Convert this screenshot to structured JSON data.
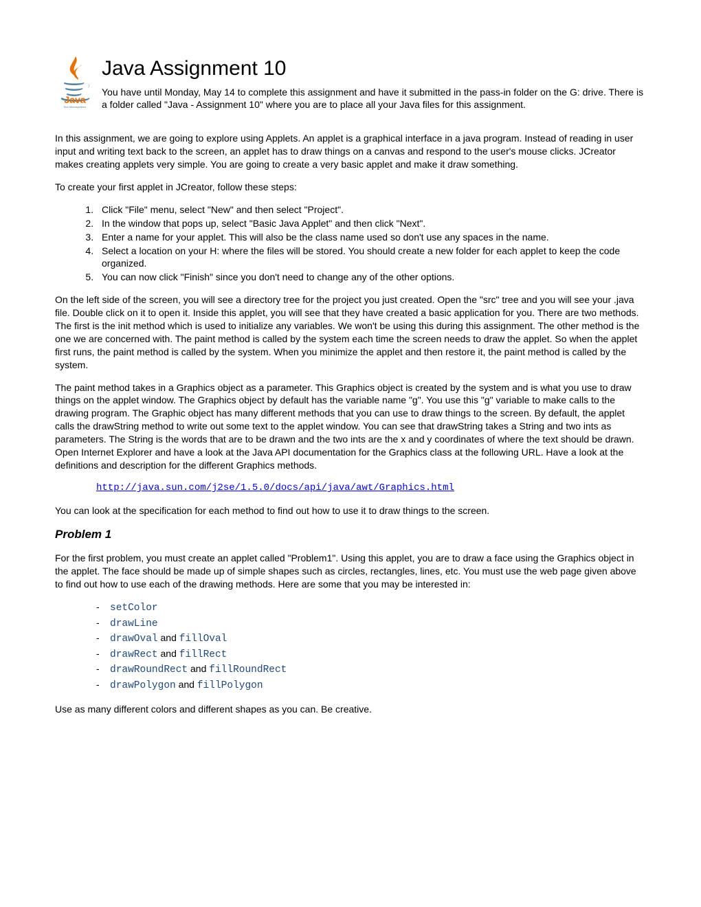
{
  "title": "Java Assignment 10",
  "intro_under_title": "You have until Monday, May 14 to complete this assignment and have it submitted in the pass-in folder on the G: drive. There is a folder called \"Java - Assignment 10\" where you are to place all your Java files for this assignment.",
  "para2": "In this assignment, we are going to explore using Applets. An applet is a graphical interface in a java program. Instead of reading in user input and writing text back to the screen, an applet has to draw things on a canvas and respond to the user's mouse clicks. JCreator makes creating applets very simple. You are going to create a very basic applet and make it draw something.",
  "steps_label": "To create your first applet in JCreator, follow these steps:",
  "steps": [
    "Click \"File\" menu, select \"New\" and then select \"Project\".",
    "In the window that pops up, select \"Basic Java Applet\" and then click \"Next\".",
    "Enter a name for your applet. This will also be the class name used so don't use any spaces in the name.",
    "Select a location on your H: where the files will be stored. You should create a new folder for each applet to keep the code organized.",
    "You can now click \"Finish\" since you don't need to change any of the other options."
  ],
  "para3": "On the left side of the screen, you will see a directory tree for the project you just created. Open the \"src\" tree and you will see your .java file. Double click on it to open it. Inside this applet, you will see that they have created a basic application for you. There are two methods. The first is the init method which is used to initialize any variables. We won't be using this during this assignment. The other method is the one we are concerned with. The paint method is called by the system each time the screen needs to draw the applet. So when the applet first runs, the paint method is called by the system. When you minimize the applet and then restore it, the paint method is called by the system.",
  "para4": "The paint method takes in a Graphics object as a parameter. This Graphics object is created by the system and is what you use to draw things on the applet window. The Graphics object by default has the variable name \"g\". You use this \"g\" variable to make calls to the drawing program. The Graphic object has many different methods that you can use to draw things to the screen. By default, the applet calls the drawString method to write out some text to the applet window. You can see that drawString takes a String and two ints as parameters. The String is the words that are to be drawn and the two ints are the x and y coordinates of where the text should be drawn. Open Internet Explorer and have a look at the Java API documentation for the Graphics class at the following URL. Have a look at the definitions and description for the different Graphics methods.",
  "url": "http://java.sun.com/j2se/1.5.0/docs/api/java/awt/Graphics.html",
  "para5": "You can look at the specification for each method to find out how to use it to draw things to the screen.",
  "problem1_heading": "Problem 1",
  "problem1_para": "For the first problem, you must create an applet called \"Problem1\". Using this applet, you are to draw a face using the Graphics object in the applet. The face should be made up of simple shapes such as circles, rectangles, lines, etc. You must use the web page given above to find out how to use each of the drawing methods. Here are some that you may be interested in:",
  "methods": [
    {
      "a": "setColor",
      "and": "",
      "b": ""
    },
    {
      "a": "drawLine",
      "and": "",
      "b": ""
    },
    {
      "a": "drawOval",
      "and": " and ",
      "b": "fillOval"
    },
    {
      "a": "drawRect",
      "and": " and ",
      "b": "fillRect"
    },
    {
      "a": "drawRoundRect",
      "and": " and ",
      "b": "fillRoundRect"
    },
    {
      "a": "drawPolygon",
      "and": " and ",
      "b": "fillPolygon"
    }
  ],
  "closing": "Use as many different colors and different shapes as you can. Be creative."
}
